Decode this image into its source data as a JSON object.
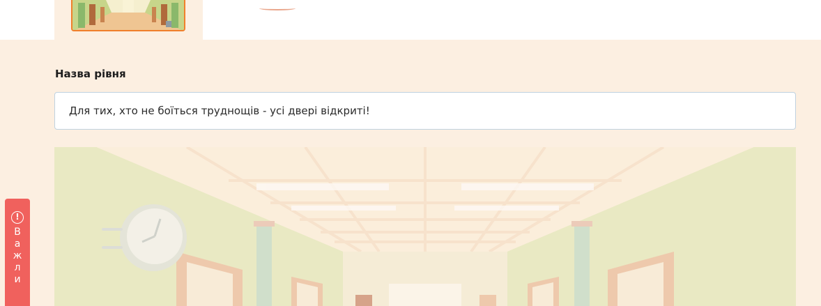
{
  "level": {
    "label": "Назва рівня",
    "value": "Для тих, хто не боїться труднощів - усі двері відкриті!"
  },
  "side_tab": {
    "icon": "alert-circle-icon",
    "letters": [
      "В",
      "а",
      "ж",
      "л",
      "и"
    ]
  },
  "colors": {
    "accent": "#f07f2b",
    "panel": "#fcefe1",
    "alert": "#f0615d"
  }
}
